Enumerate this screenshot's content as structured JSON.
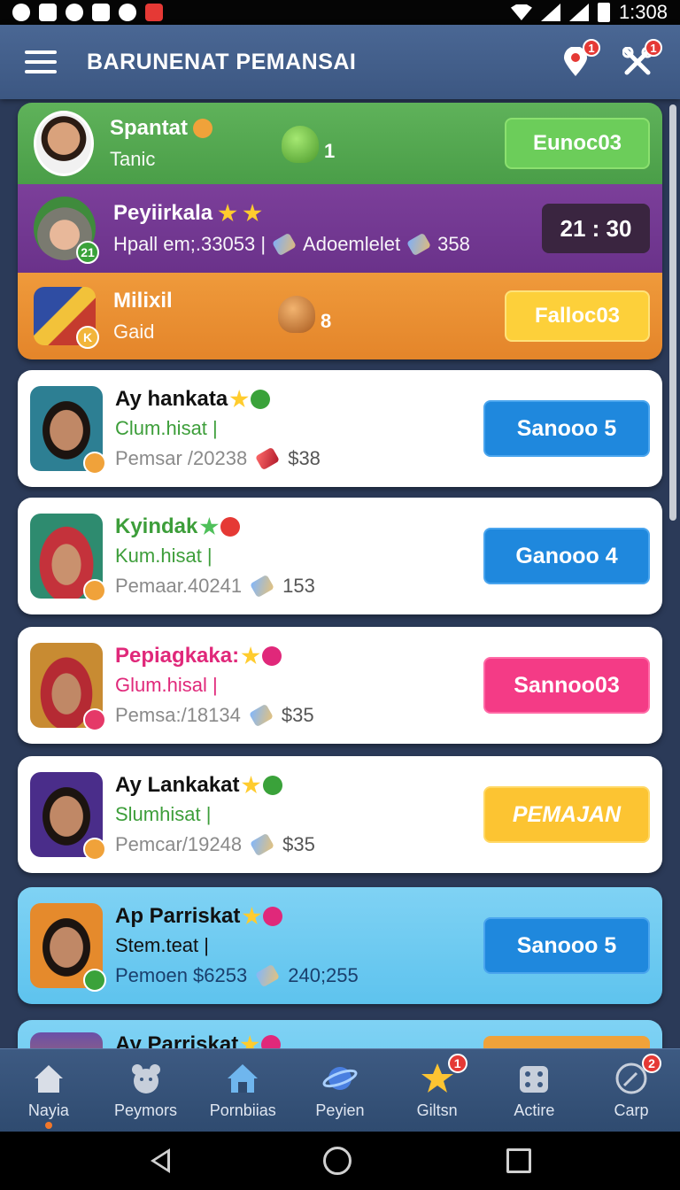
{
  "status_bar": {
    "time": "1:308"
  },
  "app_bar": {
    "title": "BARUNENAT PEMANSAI",
    "notifications_badge": "1",
    "tools_badge": "1"
  },
  "top_group": [
    {
      "name": "Spantat",
      "sub": "Tanic",
      "trophy_count": "1",
      "action": "Eunoc03",
      "avatar_badge": ""
    },
    {
      "name": "Peyiirkala",
      "stats": "Hpall em;.33053 |",
      "item1": "Adoemlelet",
      "item2": "358",
      "timer": "21 : 30",
      "avatar_badge": "21"
    },
    {
      "name": "Milixil",
      "sub": "Gaid",
      "trophy_count": "8",
      "action": "Falloc03",
      "avatar_badge": "K"
    }
  ],
  "cards": [
    {
      "name": "Ay hankata",
      "status": "Clum.hisat |",
      "meta": "Pemsar /20238",
      "amount": "$38",
      "action": "Sanooo 5",
      "name_color": "#111111",
      "status_color": "#3d9e3a"
    },
    {
      "name": "Kyindak",
      "status": "Kum.hisat |",
      "meta": "Pemaar.40241",
      "amount": "153",
      "action": "Ganooo 4",
      "name_color": "#3d9e3a",
      "status_color": "#3d9e3a"
    },
    {
      "name": "Pepiagkaka:",
      "status": "Glum.hisal |",
      "meta": "Pemsa:/18134",
      "amount": "$35",
      "action": "Sannoo03",
      "name_color": "#e0287a",
      "status_color": "#e0287a"
    },
    {
      "name": "Ay Lankakat",
      "status": "Slumhisat |",
      "meta": "Pemcar/19248",
      "amount": "$35",
      "action": "PEMAJAN",
      "name_color": "#111111",
      "status_color": "#3d9e3a"
    },
    {
      "name": "Ap Parriskat",
      "status": "Stem.teat |",
      "meta": "Pemoen $6253",
      "amount": "240;255",
      "action": "Sanooo 5",
      "name_color": "#111111",
      "status_color": "#111111"
    },
    {
      "name": "Ay Parriskat"
    }
  ],
  "bottom_nav": [
    {
      "label": "Nayia",
      "icon": "home-icon",
      "active": true
    },
    {
      "label": "Peymors",
      "icon": "bear-icon"
    },
    {
      "label": "Pornbiias",
      "icon": "house-icon"
    },
    {
      "label": "Peyien",
      "icon": "planet-icon"
    },
    {
      "label": "Giltsn",
      "icon": "star-icon",
      "badge": "1"
    },
    {
      "label": "Actire",
      "icon": "dice-icon"
    },
    {
      "label": "Carp",
      "icon": "compass-icon",
      "badge": "2"
    }
  ]
}
